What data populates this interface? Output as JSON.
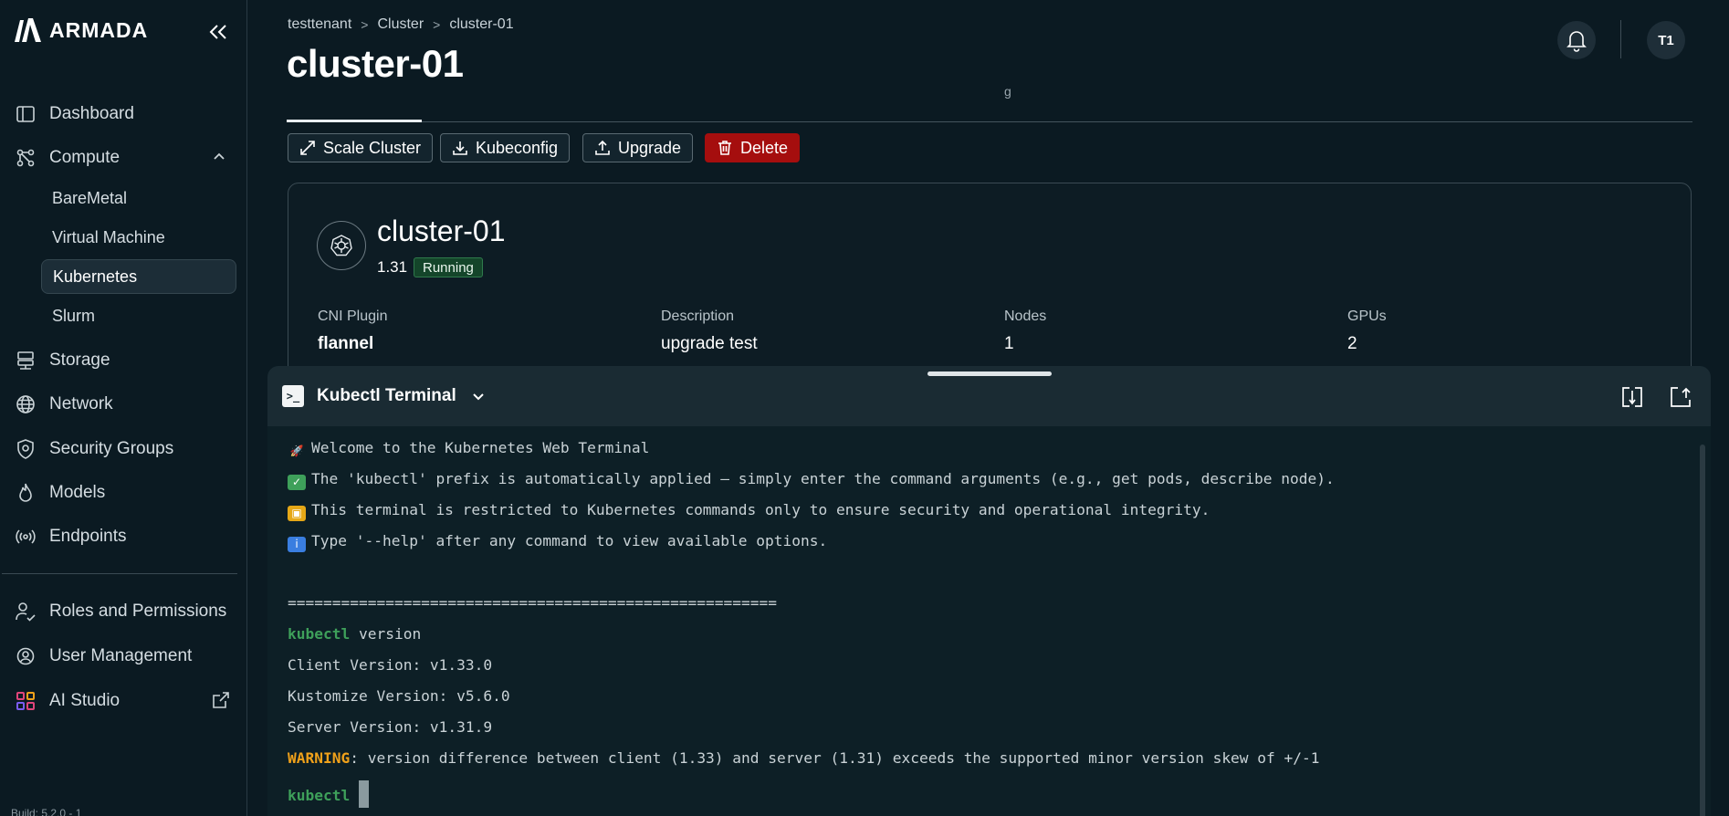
{
  "sidebar": {
    "brand": "ARMADA",
    "nav": [
      {
        "label": "Dashboard",
        "icon": "panel-icon"
      },
      {
        "label": "Compute",
        "icon": "compute-icon"
      },
      {
        "label": "Storage",
        "icon": "storage-icon"
      },
      {
        "label": "Network",
        "icon": "globe-icon"
      },
      {
        "label": "Security Groups",
        "icon": "shield-icon"
      },
      {
        "label": "Models",
        "icon": "flame-icon"
      },
      {
        "label": "Endpoints",
        "icon": "broadcast-icon"
      },
      {
        "label": "Roles and Permissions",
        "icon": "users-check-icon"
      },
      {
        "label": "User Management",
        "icon": "user-gear-icon"
      },
      {
        "label": "AI Studio",
        "icon": "grid-icon"
      }
    ],
    "compute_sub": [
      "BareMetal",
      "Virtual Machine",
      "Kubernetes",
      "Slurm"
    ],
    "active_sub": "Kubernetes",
    "build": "Build: 5.2.0 - 1"
  },
  "header": {
    "breadcrumbs": [
      "testtenant",
      "Cluster",
      "cluster-01"
    ],
    "title": "cluster-01",
    "avatar": "T1",
    "tab_glyph": "g"
  },
  "actions": {
    "scale": "Scale Cluster",
    "kubeconfig": "Kubeconfig",
    "upgrade": "Upgrade",
    "delete": "Delete"
  },
  "cluster": {
    "name": "cluster-01",
    "version": "1.31",
    "status": "Running",
    "fields": [
      {
        "label": "CNI Plugin",
        "value": "flannel"
      },
      {
        "label": "Description",
        "value": "upgrade test"
      },
      {
        "label": "Nodes",
        "value": "1"
      },
      {
        "label": "GPUs",
        "value": "2"
      }
    ]
  },
  "terminal": {
    "title": "Kubectl Terminal",
    "lines": {
      "welcome": "Welcome to the Kubernetes Web Terminal",
      "prefix": "The 'kubectl' prefix is automatically applied — simply enter the command arguments (e.g., get pods, describe node).",
      "restricted": "This terminal is restricted to Kubernetes commands only to ensure security and operational integrity.",
      "help": "Type '--help' after any command to view available options.",
      "separator": "=======================================================",
      "prompt": "kubectl",
      "cmd": " version",
      "client": "Client Version: v1.33.0",
      "kustomize": "Kustomize Version: v5.6.0",
      "server": "Server Version: v1.31.9",
      "warn_label": "WARNING",
      "warn_text": ": version difference between client (1.33) and server (1.31) exceeds the supported minor version skew of +/-1"
    }
  },
  "colors": {
    "background": "#0b1a22",
    "danger": "#a50e0e",
    "running": "#14452a",
    "prompt": "#3ea05a",
    "warning": "#f0a11a"
  }
}
